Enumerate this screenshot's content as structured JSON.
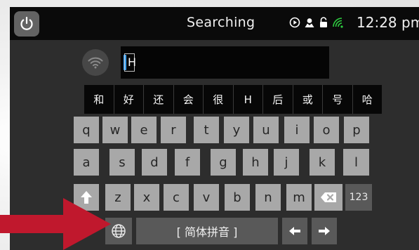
{
  "status_bar": {
    "title": "Searching",
    "time": "12:28 pm",
    "icons": [
      "play-circle-icon",
      "person-icon",
      "lock-icon",
      "wifi-icon"
    ]
  },
  "input": {
    "value": "H"
  },
  "candidates": [
    "和",
    "好",
    "还",
    "会",
    "很",
    "H",
    "后",
    "或",
    "号",
    "哈"
  ],
  "keyboard": {
    "row1": [
      "q",
      "w",
      "e",
      "r",
      "t",
      "y",
      "u",
      "i",
      "o",
      "p"
    ],
    "row2": [
      "a",
      "s",
      "d",
      "f",
      "g",
      "h",
      "j",
      "k",
      "l"
    ],
    "row3": [
      "z",
      "x",
      "c",
      "v",
      "b",
      "n",
      "m"
    ],
    "numbers_label": "123",
    "space_label": "[ 简体拼音 ]"
  },
  "colors": {
    "accent_caret": "#3aa5ff",
    "wifi_status": "#2ecc40",
    "arrow": "#c0182d"
  }
}
